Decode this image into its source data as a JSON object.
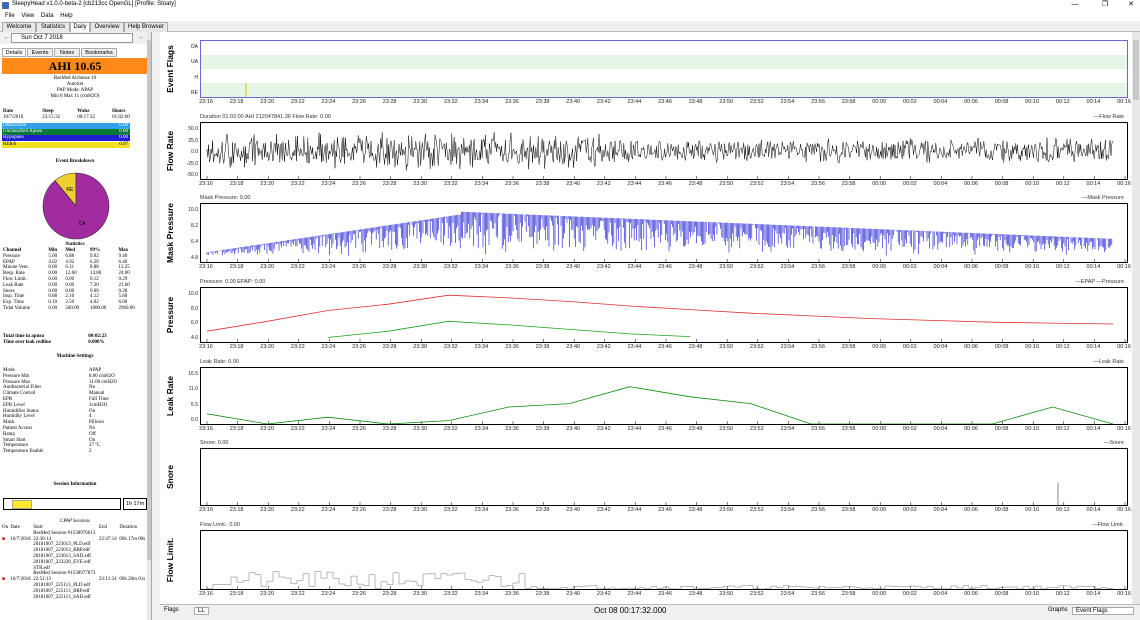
{
  "window": {
    "title": "SleepyHead v1.0.0-beta-2 [cb213cc OpenGL] [Profile: Stoaty]",
    "min": "—",
    "max": "❐",
    "close": "✕"
  },
  "menu": [
    "File",
    "View",
    "Data",
    "Help"
  ],
  "tabs": [
    "Welcome",
    "Statistics",
    "Daily",
    "Overview",
    "Help Browser"
  ],
  "date": {
    "value": "Sun Oct 7 2018",
    "prev": "←",
    "next": "→",
    "cal": "▾"
  },
  "subtabs": [
    "Details",
    "Events",
    "Notes",
    "Bookmarks"
  ],
  "ahi": "AHI 10.65",
  "device": [
    "ResMed AirSense 10",
    "AutoSet",
    "PAP Mode: APAP",
    "Min 8 Max 11 (cmH2O)"
  ],
  "session_table": {
    "headers": [
      "Date",
      "Sleep",
      "Wake",
      "Hours"
    ],
    "row": [
      "10/7/2018",
      "23:15:32",
      "00:17:32",
      "01:02:00"
    ]
  },
  "event_rows": [
    {
      "label": "Obstructive",
      "value": "0.00",
      "color": "#30a0e8"
    },
    {
      "label": "Unclassified Apnea",
      "value": "0.00",
      "color": "#0a7a3a"
    },
    {
      "label": "Hypopnea",
      "value": "0.00",
      "color": "#2020d0"
    },
    {
      "label": "RERA",
      "value": "0.97",
      "color": "#f0e020"
    }
  ],
  "event_breakdown": {
    "title": "Event Breakdown",
    "labels": [
      "RE",
      "CA"
    ],
    "values": [
      0.11,
      0.89
    ],
    "colors": [
      "#f0d030",
      "#a02ca0"
    ]
  },
  "statistics": {
    "title": "Statistics",
    "headers": [
      "Channel",
      "Min",
      "Med",
      "99%",
      "Max"
    ],
    "rows": [
      [
        "Pressure",
        "5.00",
        "6.88",
        "9.02",
        "9.40"
      ],
      [
        "EPAP",
        "4.02",
        "4.92",
        "6.20",
        "6.40"
      ],
      [
        "Minute Vent.",
        "0.00",
        "6.31",
        "8.88",
        "13.25"
      ],
      [
        "Resp. Rate",
        "0.00",
        "12.60",
        "14.80",
        "24.00"
      ],
      [
        "Flow Limit.",
        "0.00",
        "0.00",
        "0.12",
        "0.29"
      ],
      [
        "Leak Rate",
        "0.00",
        "0.00",
        "7.20",
        "21.60"
      ],
      [
        "Snore",
        "0.00",
        "0.00",
        "0.00",
        "0.28"
      ],
      [
        "Insp. Time",
        "0.88",
        "2.16",
        "4.12",
        "5.66"
      ],
      [
        "Exp. Time",
        "0.10",
        "2.50",
        "4.02",
        "6.00"
      ],
      [
        "Tidal Volume",
        "0.00",
        "500.00",
        "1000.00",
        "2960.00"
      ]
    ]
  },
  "apnea_time": {
    "label": "Total time in apnea",
    "value": "00:02:23"
  },
  "leak_redline": {
    "label": "Time over leak redline",
    "value": "0.000%"
  },
  "machine_settings": {
    "title": "Machine Settings",
    "rows": [
      [
        "Mode",
        "APAP"
      ],
      [
        "Pressure Min",
        "8.00 cmH2O"
      ],
      [
        "Pressure Max",
        "11.00 cmH2O"
      ],
      [
        "Antibacterial Filter",
        "No"
      ],
      [
        "Climate Control",
        "Manual"
      ],
      [
        "EPR",
        "Full Time"
      ],
      [
        "EPR Level",
        "3cmH2O"
      ],
      [
        "Humidifier Status",
        "On"
      ],
      [
        "Humidity Level",
        "4"
      ],
      [
        "Mask",
        "Pillows"
      ],
      [
        "Patient Access",
        "No"
      ],
      [
        "Ramp",
        "Off"
      ],
      [
        "Smart Start",
        "On"
      ],
      [
        "Temperature",
        "27 ºC"
      ],
      [
        "Temperature Enable",
        "2"
      ]
    ]
  },
  "session_info": {
    "title": "Session Information",
    "duration": "1h 17m"
  },
  "cpap_sessions": {
    "title": "CPAP Sessions",
    "headers": [
      "On",
      "Date",
      "Start",
      "End",
      "Duration"
    ],
    "lines": [
      [
        "",
        "",
        "ResMed Session #1538976613",
        "",
        ""
      ],
      [
        "■",
        "10/7/2018",
        "22:30:14",
        "22:47:14",
        "00h 17m 00s"
      ],
      [
        "",
        "",
        "20181007_223013_PLD.edf",
        "",
        ""
      ],
      [
        "",
        "",
        "20181007_223013_BRP.edf",
        "",
        ""
      ],
      [
        "",
        "",
        "20181007_223013_SAD.edf",
        "",
        ""
      ],
      [
        "",
        "",
        "20181007_223228_EVE.edf",
        "",
        ""
      ],
      [
        "",
        "",
        "STR.edf",
        "",
        ""
      ],
      [
        "",
        "",
        "ResMed Session #1538977873",
        "",
        ""
      ],
      [
        "■",
        "10/7/2018",
        "22:51:13",
        "23:11:34",
        "00h 20m 01s"
      ],
      [
        "",
        "",
        "20181007_225113_PLD.edf",
        "",
        ""
      ],
      [
        "",
        "",
        "20181007_225113_BRP.edf",
        "",
        ""
      ],
      [
        "",
        "",
        "20181007_225113_SAD.edf",
        "",
        ""
      ]
    ]
  },
  "time_ticks": [
    "23:16",
    "23:18",
    "23:20",
    "23:22",
    "23:24",
    "23:26",
    "23:28",
    "23:30",
    "23:32",
    "23:34",
    "23:36",
    "23:38",
    "23:40",
    "23:42",
    "23:44",
    "23:46",
    "23:48",
    "23:50",
    "23:52",
    "23:54",
    "23:56",
    "23:58",
    "00:00",
    "00:02",
    "00:04",
    "00:06",
    "00:08",
    "00:10",
    "00:12",
    "00:14",
    "00:16"
  ],
  "panels": [
    {
      "key": "event_flags",
      "label": "Event Flags",
      "header": "",
      "legend": "",
      "yticks": [
        "OA",
        "UA",
        "H",
        "RE"
      ]
    },
    {
      "key": "flow_rate",
      "label": "Flow Rate",
      "header": "Duration 01:02:00 AHI 212047841.36 Flow Rate: 0.00",
      "legend": "—Flow Rate",
      "yticks": [
        "50.0",
        "25.0",
        "0.0",
        "-25.0",
        "-50.0"
      ],
      "ylim": [
        -50,
        50
      ]
    },
    {
      "key": "mask_pressure",
      "label": "Mask Pressure",
      "header": "Mask Pressure: 0.00",
      "legend": "—Mask Pressure",
      "yticks": [
        "10.0",
        "8.2",
        "6.4",
        "4.8"
      ],
      "ylim": [
        4,
        10
      ]
    },
    {
      "key": "pressure",
      "label": "Pressure",
      "header": "Pressure: 0.00 EPAP: 0.00",
      "legend": "—EPAP —Pressure",
      "yticks": [
        "10.0",
        "8.0",
        "6.0",
        "4.0"
      ],
      "ylim": [
        4,
        10
      ]
    },
    {
      "key": "leak_rate",
      "label": "Leak Rate",
      "header": "Leak Rate: 0.00",
      "legend": "—Leak Rate",
      "yticks": [
        "16.5",
        "11.0",
        "5.5",
        "0.0"
      ],
      "ylim": [
        0,
        16.5
      ]
    },
    {
      "key": "snore",
      "label": "Snore",
      "header": "Snore: 0.00",
      "legend": "—Snore",
      "yticks": [
        "",
        "",
        ""
      ],
      "ylim": [
        0,
        1
      ]
    },
    {
      "key": "flow_limit",
      "label": "Flow Limit.",
      "header": "Flow Limit.: 0.00",
      "legend": "—Flow Limit.",
      "yticks": [
        "",
        "",
        ""
      ],
      "ylim": [
        0,
        1
      ]
    }
  ],
  "chart_data": {
    "type": "line",
    "x": [
      "23:16",
      "23:20",
      "23:24",
      "23:28",
      "23:32",
      "23:36",
      "23:40",
      "23:44",
      "23:48",
      "23:52",
      "23:56",
      "00:00",
      "00:04",
      "00:08",
      "00:12",
      "00:16"
    ],
    "series": [
      {
        "name": "Pressure",
        "values": [
          5.2,
          6.3,
          7.5,
          8.2,
          9.2,
          8.9,
          8.5,
          8.0,
          7.6,
          7.2,
          6.9,
          6.6,
          6.4,
          6.2,
          6.1,
          6.0
        ]
      },
      {
        "name": "EPAP",
        "values": [
          null,
          null,
          4.5,
          5.2,
          6.3,
          5.9,
          5.4,
          4.9,
          4.6,
          null,
          null,
          null,
          null,
          null,
          null,
          null
        ]
      },
      {
        "name": "Leak Rate",
        "values": [
          3,
          0,
          2,
          0,
          1,
          5,
          6,
          11,
          8,
          6,
          0,
          0,
          0,
          0,
          5,
          0
        ]
      }
    ],
    "colors": {
      "Pressure": "#e03030",
      "EPAP": "#20a020",
      "Leak Rate": "#108a10",
      "Mask Pressure": "#1010d0",
      "Flow Rate": "#000000"
    }
  },
  "bottom": {
    "flags": "Flags",
    "ll": "LL",
    "timestamp": "Oct 08 00:17:32.000",
    "graphs": "Graphs",
    "event_flags": "Event Flags"
  }
}
